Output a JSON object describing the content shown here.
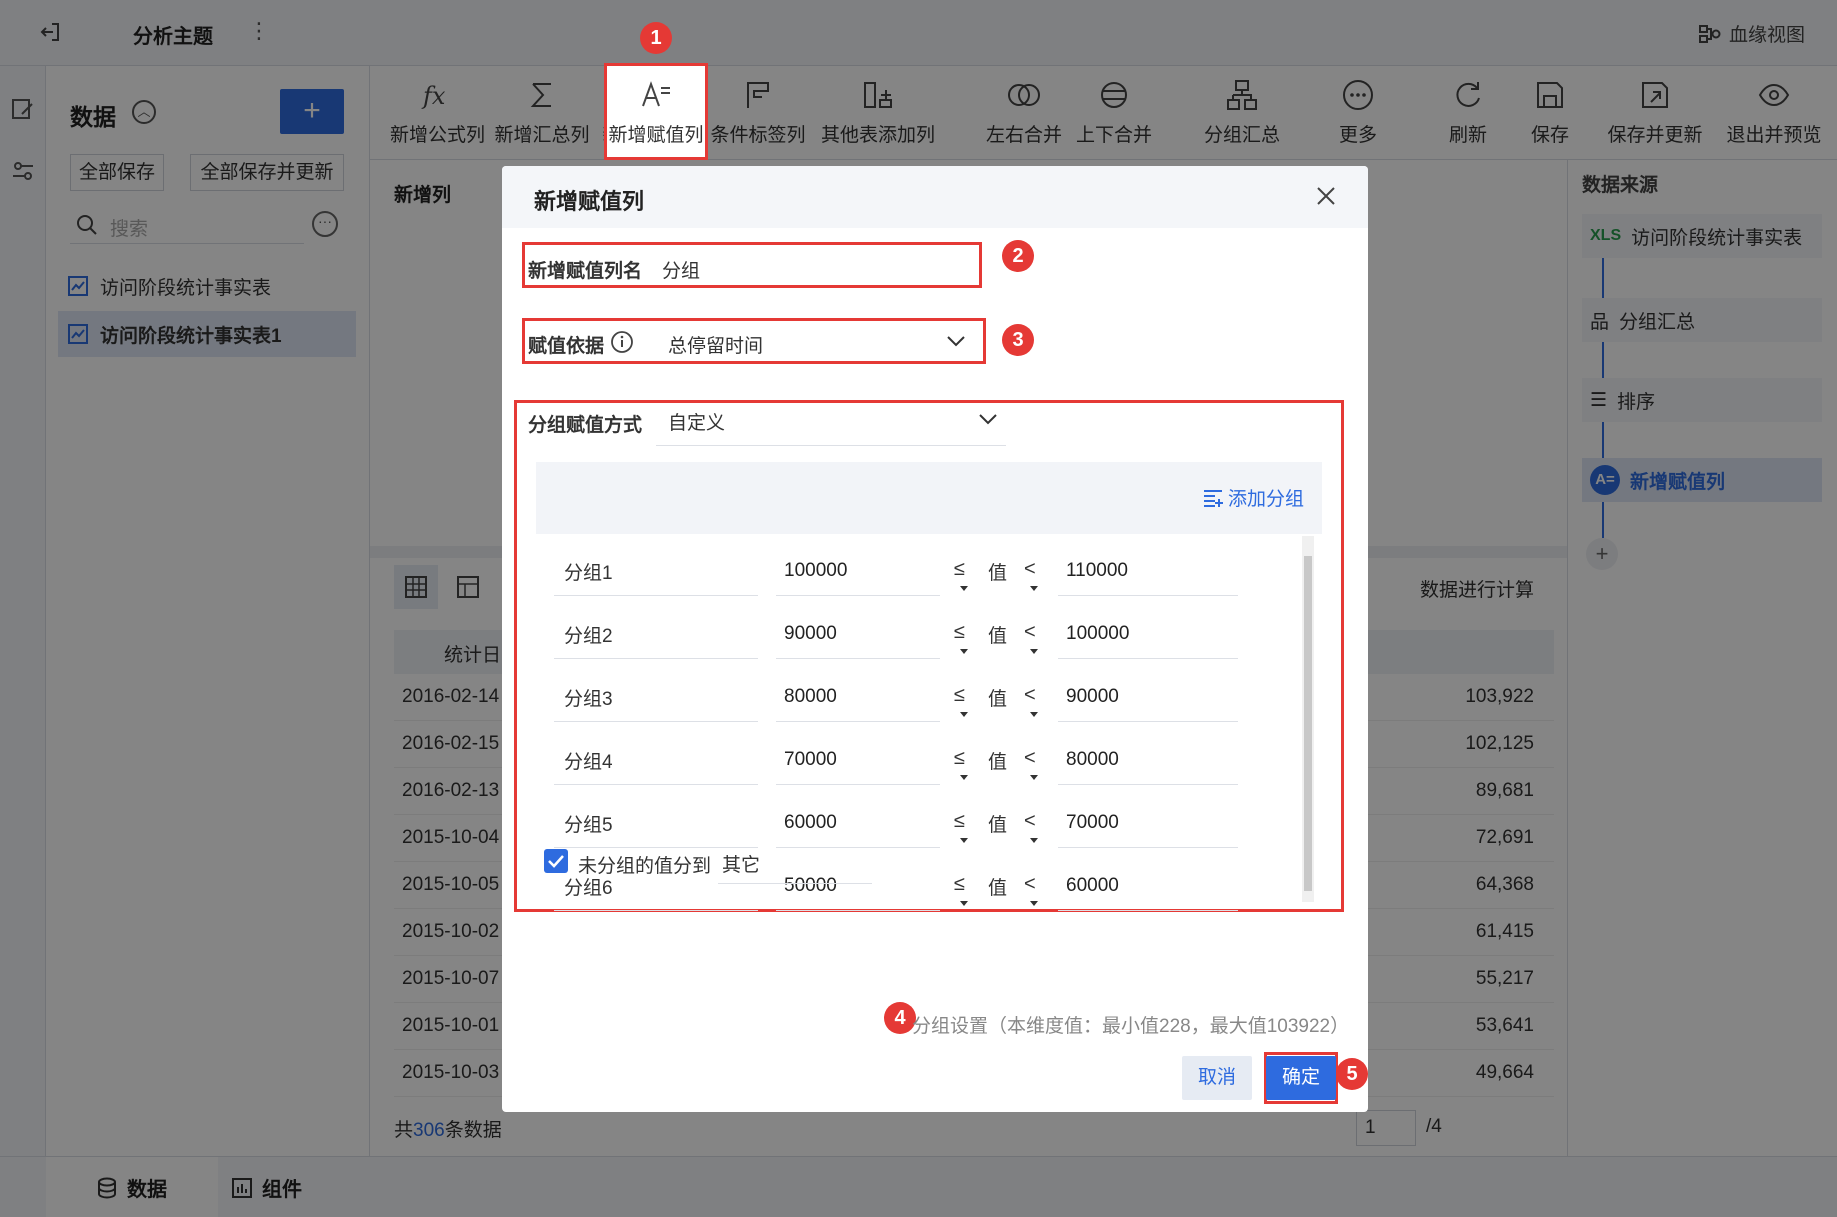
{
  "app": {
    "title": "分析主题",
    "more": "⋮",
    "lineage": "血缘视图"
  },
  "data_panel": {
    "title": "数据",
    "add": "+",
    "save_all": "全部保存",
    "save_all_update": "全部保存并更新",
    "search_placeholder": "搜索",
    "tables": [
      "访问阶段统计事实表",
      "访问阶段统计事实表1"
    ]
  },
  "toolbar": {
    "items": [
      "新增公式列",
      "新增汇总列",
      "新增赋值列",
      "条件标签列",
      "其他表添加列",
      "左右合并",
      "上下合并",
      "分组汇总",
      "更多",
      "刷新",
      "保存",
      "保存并更新",
      "退出并预览"
    ]
  },
  "center": {
    "new_col_label": "新增列",
    "col_header": "统计日",
    "rows": [
      {
        "date": "2016-02-14",
        "value": "103,922"
      },
      {
        "date": "2016-02-15",
        "value": "102,125"
      },
      {
        "date": "2016-02-13",
        "value": "89,681"
      },
      {
        "date": "2015-10-04",
        "value": "72,691"
      },
      {
        "date": "2015-10-05",
        "value": "64,368"
      },
      {
        "date": "2015-10-02",
        "value": "61,415"
      },
      {
        "date": "2015-10-07",
        "value": "55,217"
      },
      {
        "date": "2015-10-01",
        "value": "53,641"
      },
      {
        "date": "2015-10-03",
        "value": "49,664"
      }
    ],
    "calc_label": "数据进行计算",
    "total_prefix": "共",
    "total_count": "306",
    "total_suffix": "条数据",
    "page_input": "1",
    "page_total": "/4"
  },
  "right_panel": {
    "title": "数据来源",
    "source": "访问阶段统计事实表",
    "steps": [
      "分组汇总",
      "排序",
      "新增赋值列"
    ],
    "add": "+"
  },
  "bottom": {
    "tab_data": "数据",
    "tab_component": "组件"
  },
  "dialog": {
    "title": "新增赋值列",
    "name_label": "新增赋值列名",
    "name_value": "分组",
    "basis_label": "赋值依据",
    "basis_value": "总停留时间",
    "method_label": "分组赋值方式",
    "method_value": "自定义",
    "add_group": "添加分组",
    "groups": [
      {
        "name": "分组1",
        "low": "100000",
        "op1": "≤",
        "word": "值",
        "op2": "<",
        "high": "110000"
      },
      {
        "name": "分组2",
        "low": "90000",
        "op1": "≤",
        "word": "值",
        "op2": "<",
        "high": "100000"
      },
      {
        "name": "分组3",
        "low": "80000",
        "op1": "≤",
        "word": "值",
        "op2": "<",
        "high": "90000"
      },
      {
        "name": "分组4",
        "low": "70000",
        "op1": "≤",
        "word": "值",
        "op2": "<",
        "high": "80000"
      },
      {
        "name": "分组5",
        "low": "60000",
        "op1": "≤",
        "word": "值",
        "op2": "<",
        "high": "70000"
      },
      {
        "name": "分组6",
        "low": "50000",
        "op1": "≤",
        "word": "值",
        "op2": "<",
        "high": "60000"
      }
    ],
    "ungrouped_label": "未分组的值分到",
    "ungrouped_value": "其它",
    "hint": "分组设置（本维度值：最小值228，最大值103922）",
    "cancel": "取消",
    "confirm": "确定",
    "badges": [
      "1",
      "2",
      "3",
      "4",
      "5"
    ]
  },
  "colors": {
    "accent": "#2e6bdf",
    "highlight_red": "#e53935"
  }
}
